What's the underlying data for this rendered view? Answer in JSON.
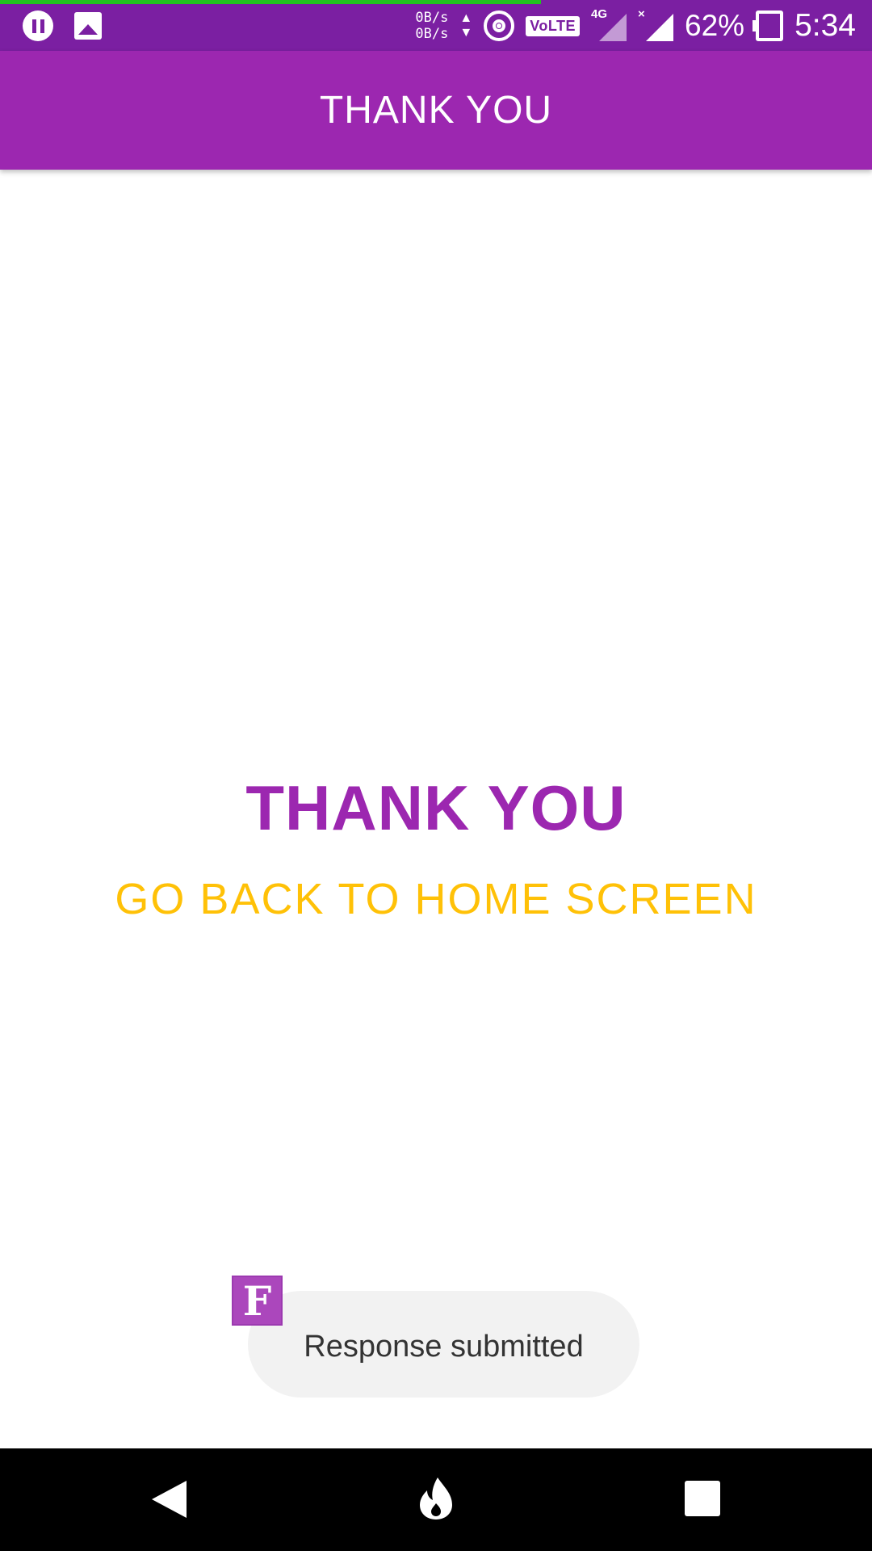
{
  "status_bar": {
    "net_speed_up": "0B/s",
    "net_speed_down": "0B/s",
    "volte": "VoLTE",
    "network_type": "4G",
    "no_service_mark": "×",
    "battery_percent": "62%",
    "time": "5:34",
    "progress_percent": 62
  },
  "app_bar": {
    "title": "THANK YOU"
  },
  "main": {
    "heading": "THANK YOU",
    "home_link": "GO BACK TO HOME SCREEN"
  },
  "toast": {
    "app_icon_letter": "F",
    "message": "Response submitted"
  },
  "nav_bar": {
    "back": "back-icon",
    "home": "home-icon",
    "recents": "recents-icon"
  },
  "colors": {
    "status_bar": "#7b1fa2",
    "app_bar": "#9c27b0",
    "heading": "#9c27b0",
    "link": "#ffc107",
    "toast_bg": "#f2f2f2"
  }
}
